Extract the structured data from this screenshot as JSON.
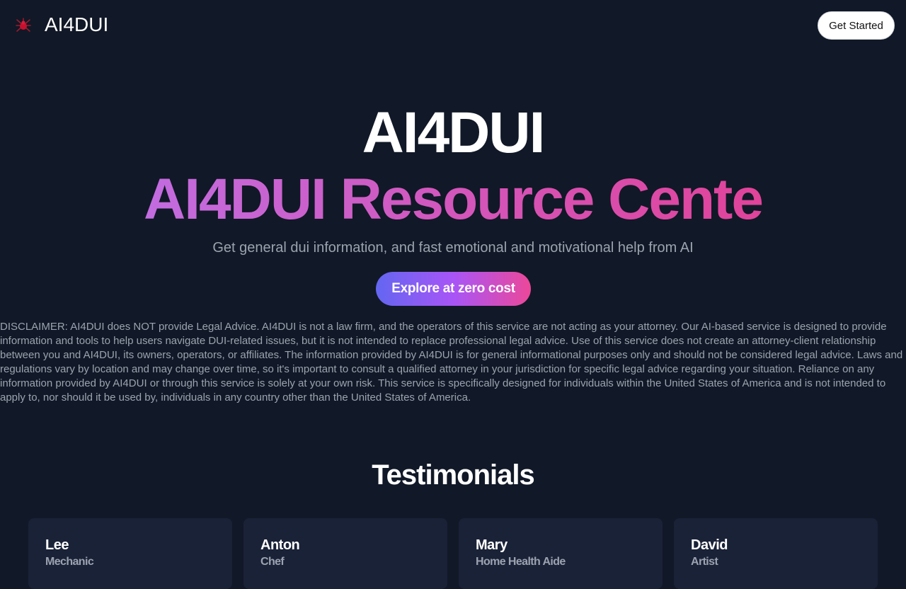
{
  "header": {
    "logo_icon": "spider-bug-icon",
    "brand": "AI4DUI",
    "get_started_label": "Get Started"
  },
  "hero": {
    "title": "AI4DUI",
    "subtitle": "AI4DUI Resource Cente",
    "tagline": "Get general dui information, and fast emotional and motivational help from AI",
    "cta_label": "Explore at zero cost"
  },
  "disclaimer": "DISCLAIMER: AI4DUI does NOT provide Legal Advice. AI4DUI is not a law firm, and the operators of this service are not acting as your attorney. Our AI-based service is designed to provide information and tools to help users navigate DUI-related issues, but it is not intended to replace professional legal advice. Use of this service does not create an attorney-client relationship between you and AI4DUI, its owners, operators, or affiliates. The information provided by AI4DUI is for general informational purposes only and should not be considered legal advice. Laws and regulations vary by location and may change over time, so it's important to consult a qualified attorney in your jurisdiction for specific legal advice regarding your situation. Reliance on any information provided by AI4DUI or through this service is solely at your own risk. This service is specifically designed for individuals within the United States of America and is not intended to apply to, nor should it be used by, individuals in any country other than the United States of America.",
  "testimonials": {
    "title": "Testimonials",
    "items": [
      {
        "name": "Lee",
        "role": "Mechanic"
      },
      {
        "name": "Anton",
        "role": "Chef"
      },
      {
        "name": "Mary",
        "role": "Home Health Aide"
      },
      {
        "name": "David",
        "role": "Artist"
      }
    ]
  },
  "colors": {
    "background": "#111827",
    "card": "#1a2238",
    "muted_text": "#9ca3af",
    "gradient_start": "#6366f1",
    "gradient_mid": "#a855f7",
    "gradient_end": "#ec4899"
  }
}
